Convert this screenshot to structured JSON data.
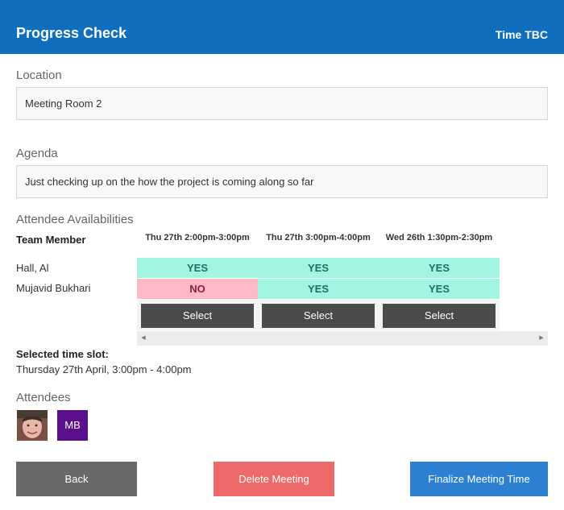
{
  "header": {
    "title": "Progress Check",
    "time": "Time TBC"
  },
  "location": {
    "label": "Location",
    "value": "Meeting Room 2"
  },
  "agenda": {
    "label": "Agenda",
    "value": "Just checking up on the how the project is coming along so far"
  },
  "availability": {
    "title": "Attendee Availabilities",
    "member_header": "Team Member",
    "slots": [
      "Thu 27th 2:00pm-3:00pm",
      "Thu 27th 3:00pm-4:00pm",
      "Wed 26th 1:30pm-2:30pm"
    ],
    "members": [
      {
        "name": "Hall, Al",
        "answers": [
          "YES",
          "YES",
          "YES"
        ]
      },
      {
        "name": "Mujavid Bukhari",
        "answers": [
          "NO",
          "YES",
          "YES"
        ]
      }
    ],
    "select_label": "Select",
    "colors": {
      "yes": "#a3f5e3",
      "no": "#ffb9c6"
    }
  },
  "selected": {
    "label": "Selected time slot:",
    "value": "Thursday 27th April, 3:00pm - 4:00pm"
  },
  "attendees": {
    "label": "Attendees",
    "initials": "MB"
  },
  "buttons": {
    "back": "Back",
    "delete": "Delete Meeting",
    "finalize": "Finalize Meeting Time"
  },
  "theme": {
    "header": "#106ebe",
    "accent": "#2d80d2",
    "danger": "#ee6a6a",
    "neutral": "#696969"
  }
}
